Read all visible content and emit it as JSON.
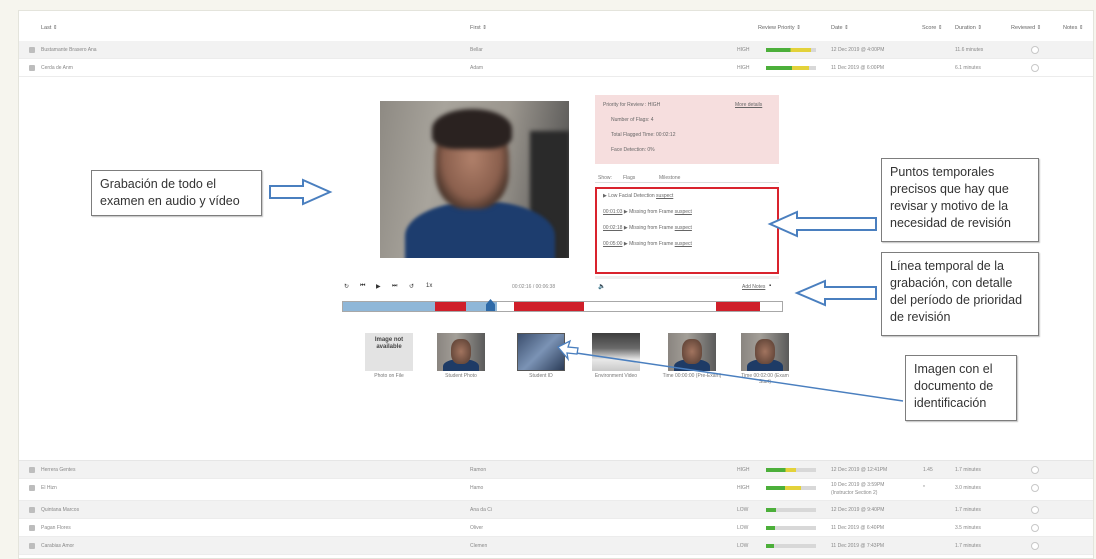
{
  "table": {
    "headers": [
      "Last ⇕",
      "First ⇕",
      "Review Priority ⇕",
      "Date ⇕",
      "Score ⇕",
      "Duration ⇕",
      "Reviewed ⇕",
      "Notes ⇕"
    ],
    "rows_top": [
      {
        "last": "Bustamante Brasero Ana",
        "first": "Bellar",
        "priority": "HIGH",
        "date": "12 Dec 2019 @ 4:00PM",
        "score": "",
        "duration": "11.6 minutes",
        "level": 0.9
      },
      {
        "last": "Cerda de Anm",
        "first": "Adam",
        "priority": "HIGH",
        "date": "11 Dec 2019 @ 6:00PM",
        "score": "",
        "duration": "6.1 minutes",
        "level": 0.85
      }
    ],
    "rows_bottom": [
      {
        "last": "Herrera Gentes",
        "first": "Ramon",
        "priority": "HIGH",
        "date": "12 Dec 2019 @ 12:41PM",
        "score": "1.45",
        "duration": "1.7 minutes",
        "level": 0.6
      },
      {
        "last": "El Hizn",
        "first": "Hamo",
        "priority": "HIGH",
        "date": "10 Dec 2019 @ 3:59PM",
        "date2": "(Instructor Section 2)",
        "score": "*",
        "duration": "3.0 minutes",
        "level": 0.7
      },
      {
        "last": "Quintana Marcos",
        "first": "Ana da Ci",
        "priority": "LOW",
        "date": "12 Dec 2019 @ 9:40PM",
        "score": "",
        "duration": "1.7 minutes",
        "level": 0.2
      },
      {
        "last": "Pagan Flores",
        "first": "Oliver",
        "priority": "LOW",
        "date": "11 Dec 2019 @ 6:40PM",
        "score": "",
        "duration": "3.5 minutes",
        "level": 0.18
      },
      {
        "last": "Carabias Amor",
        "first": "Clemen",
        "priority": "LOW",
        "date": "11 Dec 2019 @ 7:43PM",
        "score": "",
        "duration": "1.7 minutes",
        "level": 0.15
      }
    ]
  },
  "review_panel": {
    "priority": "Priority for Review : HIGH",
    "more": "More details",
    "num_flags": "Number of Flags: 4",
    "total_flagged": "Total Flagged Time: 00:02:12",
    "face_detection": "Face Detection: 0%",
    "show_label": "Show:",
    "flags_tab": "Flags",
    "milestone_tab": "Milestone",
    "flags": [
      {
        "time": "",
        "text": "Low Facial Detection",
        "action": "suspect"
      },
      {
        "time": "00:01:03",
        "text": "Missing from Frame",
        "action": "suspect"
      },
      {
        "time": "00:02:18",
        "text": "Missing from Frame",
        "action": "suspect"
      },
      {
        "time": "00:05:00",
        "text": "Missing from Frame",
        "action": "suspect"
      }
    ]
  },
  "player": {
    "time": "00:02:16 / 00:06:38",
    "speed": "1x",
    "export": "Add Notes",
    "progress": 0.35,
    "segments": [
      {
        "start": 0.0,
        "end": 0.21,
        "color": "#8fb7d8"
      },
      {
        "start": 0.21,
        "end": 0.28,
        "color": "#cf1f2a"
      },
      {
        "start": 0.28,
        "end": 0.35,
        "color": "#8fb7d8"
      },
      {
        "start": 0.39,
        "end": 0.55,
        "color": "#cf1f2a"
      },
      {
        "start": 0.85,
        "end": 0.95,
        "color": "#cf1f2a"
      }
    ]
  },
  "thumbnails": [
    {
      "label": "Photo on File",
      "kind": "noimg",
      "noimg_text": "Image not available"
    },
    {
      "label": "Student Photo",
      "kind": "face"
    },
    {
      "label": "Student ID",
      "kind": "id"
    },
    {
      "label": "Environment Video",
      "kind": "env"
    },
    {
      "label": "Time 00:00:00 (Pre-Exam)",
      "kind": "face"
    },
    {
      "label": "Time 00:02:00 (Exam Start)",
      "kind": "face"
    }
  ],
  "callouts": {
    "recording": "Grabación de todo el examen en audio y vídeo",
    "timepoints": "Puntos temporales precisos que hay que revisar y motivo de la necesidad de revisión",
    "timeline": "Línea temporal de la grabación, con detalle del período de prioridad de revisión",
    "id_image": "Imagen con el documento de identificación"
  },
  "colors": {
    "high": "#e3d23a",
    "bar_green": "#4caf3a",
    "flag_border": "#d9232d",
    "arrow": "#4a7fbf"
  }
}
